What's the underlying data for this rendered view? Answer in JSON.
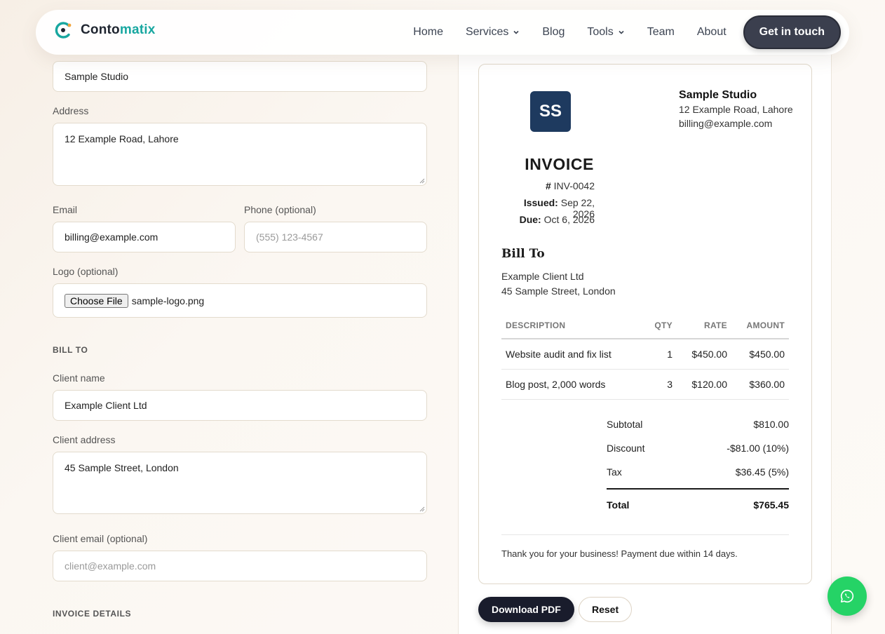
{
  "brand": {
    "name_a": "Conto",
    "name_b": "matix"
  },
  "nav": {
    "items": [
      {
        "label": "Home"
      },
      {
        "label": "Services",
        "dropdown": true
      },
      {
        "label": "Blog"
      },
      {
        "label": "Tools",
        "dropdown": true
      },
      {
        "label": "Team"
      },
      {
        "label": "About"
      }
    ],
    "cta_label": "Get in touch"
  },
  "form": {
    "business_name_value": "Sample Studio",
    "address_label": "Address",
    "address_value": "12 Example Road, Lahore",
    "email_label": "Email",
    "email_value": "billing@example.com",
    "phone_label": "Phone (optional)",
    "phone_placeholder": "(555) 123-4567",
    "logo_label": "Logo (optional)",
    "logo_button": "Choose File",
    "logo_filename": "sample-logo.png",
    "bill_to_section": "BILL TO",
    "client_name_label": "Client name",
    "client_name_value": "Example Client Ltd",
    "client_address_label": "Client address",
    "client_address_value": "45 Sample Street, London",
    "client_email_label": "Client email (optional)",
    "client_email_placeholder": "client@example.com",
    "invoice_details_section": "INVOICE DETAILS"
  },
  "invoice": {
    "logo_initials": "SS",
    "title": "INVOICE",
    "number_prefix": "#",
    "number": "INV-0042",
    "issued_label": "Issued:",
    "issued_value": "Sep 22, 2026",
    "due_label": "Due:",
    "due_value": "Oct 6, 2026",
    "seller_name": "Sample Studio",
    "seller_address": "12 Example Road, Lahore",
    "seller_email": "billing@example.com",
    "bill_to_heading": "Bill To",
    "client_name": "Example Client Ltd",
    "client_address": "45 Sample Street, London",
    "columns": [
      "DESCRIPTION",
      "QTY",
      "RATE",
      "AMOUNT"
    ],
    "rows": [
      [
        "Website audit and fix list",
        "1",
        "$450.00",
        "$450.00"
      ],
      [
        "Blog post, 2,000 words",
        "3",
        "$120.00",
        "$360.00"
      ]
    ],
    "subtotal_label": "Subtotal",
    "subtotal_value": "$810.00",
    "discount_label": "Discount",
    "discount_value": "-$81.00 (10%)",
    "tax_label": "Tax",
    "tax_value": "$36.45 (5%)",
    "total_label": "Total",
    "total_value": "$765.45",
    "thanks": "Thank you for your business! Payment due within 14 days."
  },
  "actions": {
    "download_label": "Download PDF",
    "reset_label": "Reset"
  },
  "colors": {
    "accent": "#18a7a0",
    "logo_bg": "#1e3a5f",
    "whatsapp": "#25d366"
  }
}
